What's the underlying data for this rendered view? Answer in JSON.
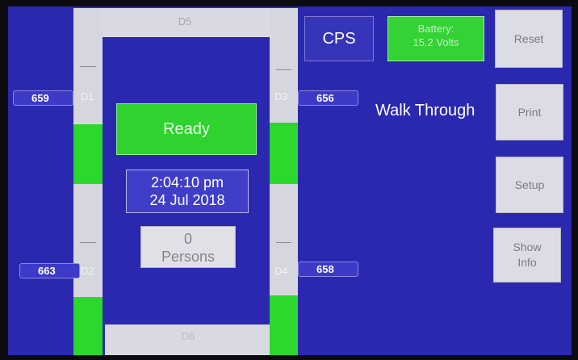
{
  "doors": {
    "d1": {
      "label": "D1",
      "count": "659"
    },
    "d2": {
      "label": "D2",
      "count": "663"
    },
    "d3": {
      "label": "D3",
      "count": "656"
    },
    "d4": {
      "label": "D4",
      "count": "658"
    },
    "d5": {
      "label": "D5"
    },
    "d6": {
      "label": "D6"
    }
  },
  "status": {
    "label": "Ready",
    "color": "#2fd22f"
  },
  "clock": {
    "time": "2:04:10 pm",
    "date": "24 Jul 2018"
  },
  "persons": {
    "count": "0",
    "label": "Persons"
  },
  "header": {
    "cps_label": "CPS",
    "battery_title": "Battery:",
    "battery_value": "15.2 Volts",
    "mode": "Walk Through"
  },
  "side_buttons": {
    "reset": "Reset",
    "print": "Print",
    "setup": "Setup",
    "show_info_line1": "Show",
    "show_info_line2": "Info"
  },
  "colors": {
    "screen_bg": "#2b28b0",
    "sensor_active": "#2cd82c",
    "button_bg": "#dcdce4"
  }
}
